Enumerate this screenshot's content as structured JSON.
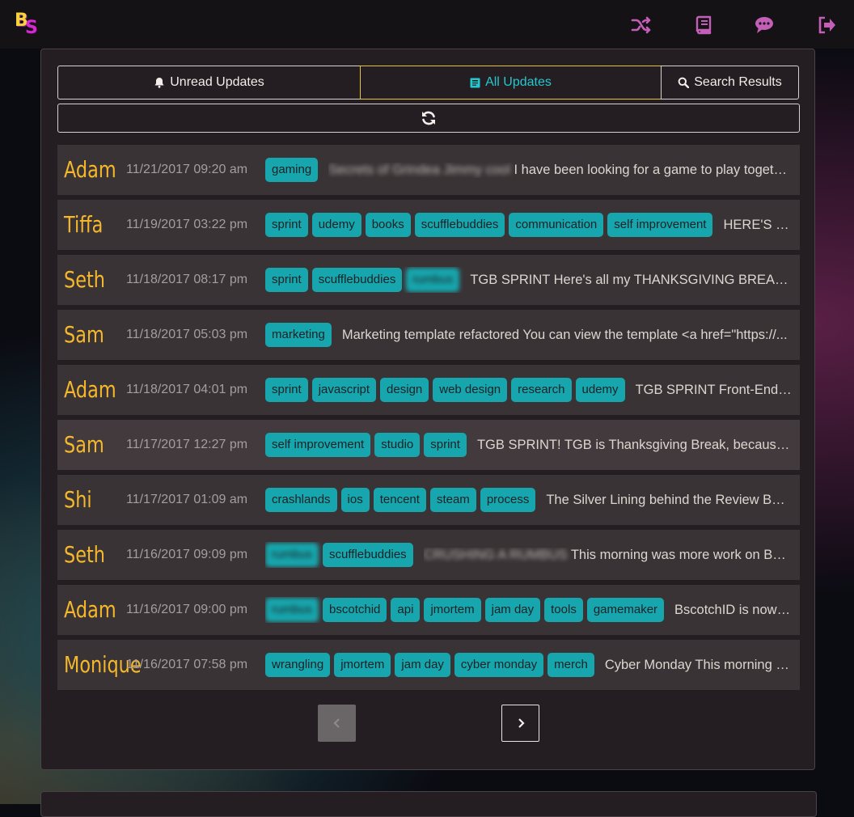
{
  "app": {
    "logo_text_b": "B",
    "logo_text_s": "S"
  },
  "nav": {
    "icons": [
      "shuffle-icon",
      "book-icon",
      "chat-icon",
      "logout-icon"
    ],
    "icon_color": "#c45fb8"
  },
  "tabs": [
    {
      "label": "Unread Updates",
      "icon": "bell-icon"
    },
    {
      "label": "All Updates",
      "icon": "newspaper-icon",
      "active": true
    },
    {
      "label": "Search Results",
      "icon": "search-icon"
    }
  ],
  "colors": {
    "accent_tab_border": "#e3c43a",
    "active_tab_text": "#22c8cf",
    "tag_bg": "#17a6ad",
    "username": "#f5b82a"
  },
  "updates": [
    {
      "user": "Adam",
      "date": "11/21/2017 09:20 am",
      "tags": [
        "gaming"
      ],
      "blurred_text": "Secrets of Grindea Jimmy cool",
      "message": "I have been looking for a game to play together with my friends and I found one!"
    },
    {
      "user": "Tiffa",
      "date": "11/19/2017 03:22 pm",
      "tags": [
        "sprint",
        "udemy",
        "books",
        "scufflebuddies",
        "communication",
        "self improvement"
      ],
      "message": "HERE'S MY SPRINT UPDATE"
    },
    {
      "user": "Seth",
      "date": "11/18/2017 08:17 pm",
      "tags": [
        "sprint",
        "scufflebuddies"
      ],
      "blurred_tag": "rumbus",
      "message": "TGB SPRINT Here's all my THANKSGIVING BREAK sprint plans"
    },
    {
      "user": "Sam",
      "date": "11/18/2017 05:03 pm",
      "tags": [
        "marketing"
      ],
      "message": "Marketing template refactored You can view the template <a href=\"https://..."
    },
    {
      "user": "Adam",
      "date": "11/18/2017 04:01 pm",
      "tags": [
        "sprint",
        "javascript",
        "design",
        "web design",
        "research",
        "udemy"
      ],
      "message": "TGB SPRINT Front-End Development"
    },
    {
      "user": "Sam",
      "date": "11/17/2017 12:27 pm",
      "tags": [
        "self improvement",
        "studio",
        "sprint"
      ],
      "message": "TGB SPRINT! TGB is Thanksgiving Break, because it is Thanksgiving"
    },
    {
      "user": "Shi",
      "date": "11/17/2017 01:09 am",
      "tags": [
        "crashlands",
        "ios",
        "tencent",
        "steam",
        "process"
      ],
      "message": "The Silver Lining behind the Review Bomb"
    },
    {
      "user": "Seth",
      "date": "11/16/2017 09:09 pm",
      "blurred_tag_first": "rumbus",
      "tags": [
        "scufflebuddies"
      ],
      "blurred_text": "CRUSHING A RUMBUS",
      "message": "This morning was more work on Bscotch things"
    },
    {
      "user": "Adam",
      "date": "11/16/2017 09:00 pm",
      "blurred_tag_first": "rumbus",
      "tags": [
        "bscotchid",
        "api",
        "jmortem",
        "jam day",
        "tools",
        "gamemaker"
      ],
      "message": "BscotchID is now live"
    },
    {
      "user": "Monique",
      "date": "11/16/2017 07:58 pm",
      "tags": [
        "wrangling",
        "jmortem",
        "jam day",
        "cyber monday",
        "merch"
      ],
      "message": "Cyber Monday This morning I worked on merch"
    }
  ],
  "pager": {
    "prev_symbol": "‹",
    "next_symbol": "›"
  }
}
